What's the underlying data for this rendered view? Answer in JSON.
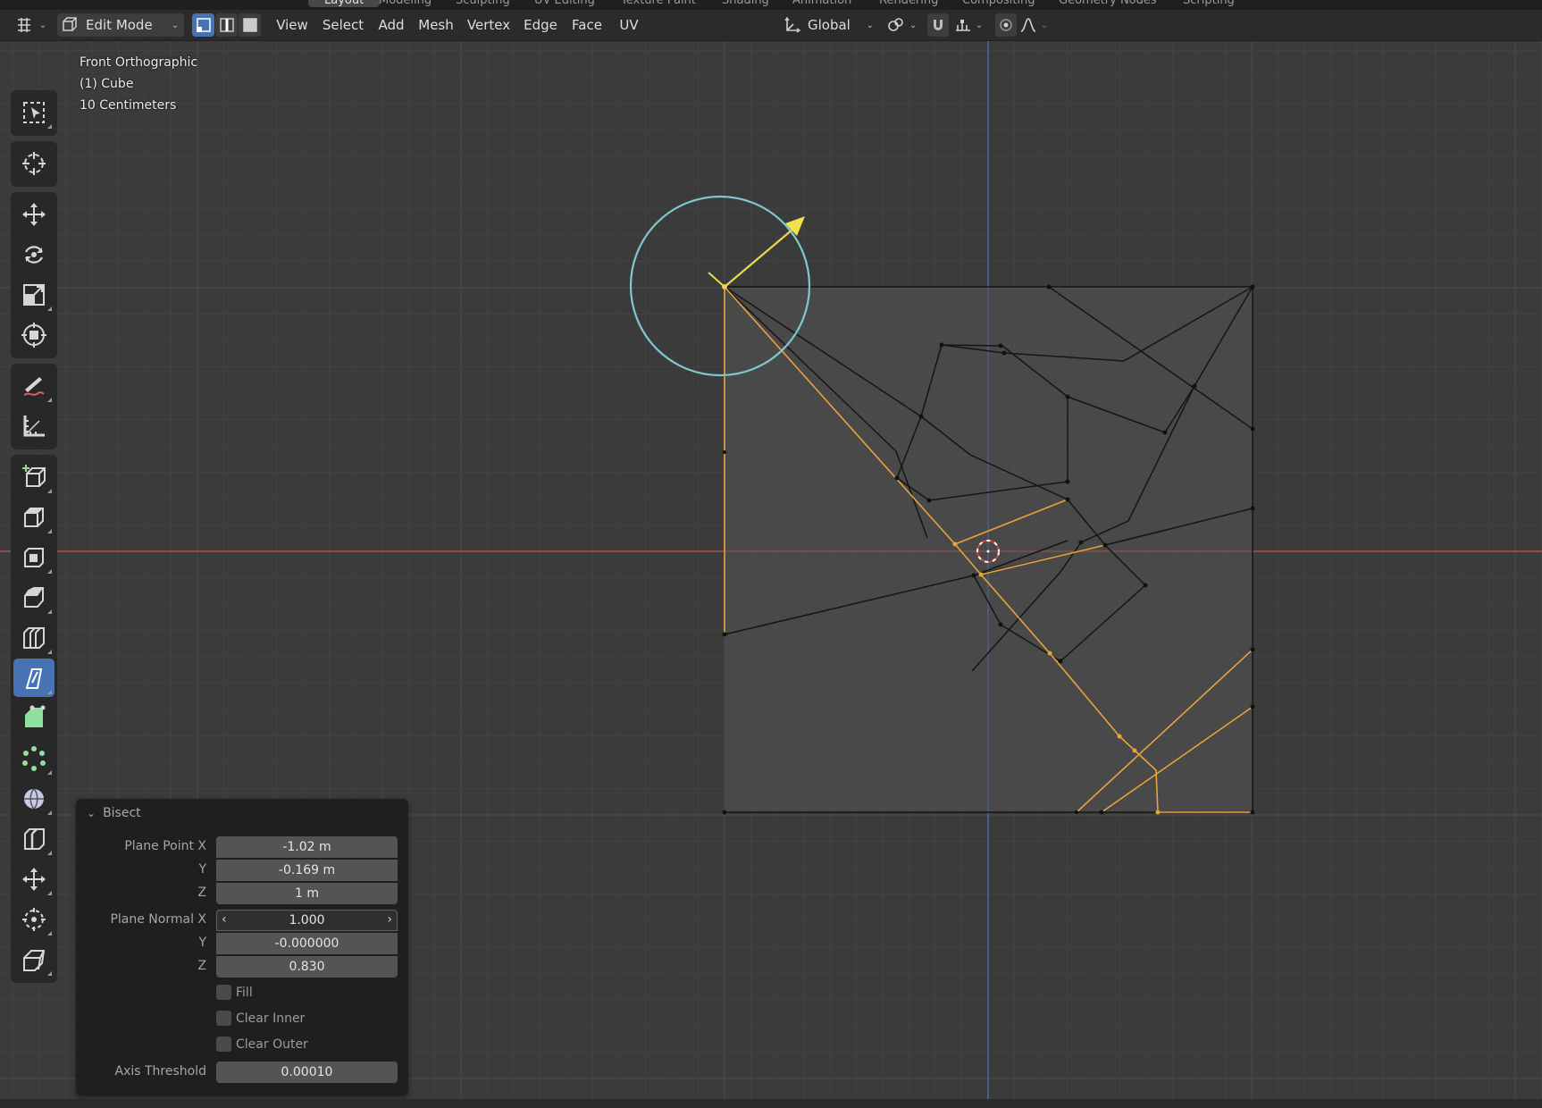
{
  "workspace_tabs": [
    "Layout",
    "Modeling",
    "Sculpting",
    "UV Editing",
    "Texture Paint",
    "Shading",
    "Animation",
    "Rendering",
    "Compositing",
    "Geometry Nodes",
    "Scripting"
  ],
  "header": {
    "mode": "Edit Mode",
    "menus": [
      "View",
      "Select",
      "Add",
      "Mesh",
      "Vertex",
      "Edge",
      "Face",
      "UV"
    ],
    "orientation": "Global"
  },
  "viewport": {
    "view_name": "Front Orthographic",
    "object_name": "(1) Cube",
    "grid_scale": "10 Centimeters"
  },
  "toolbar": {
    "tools": [
      "select-box",
      "cursor",
      "move",
      "rotate",
      "scale",
      "transform",
      "annotate",
      "measure",
      "add-cube",
      "extrude-region",
      "inset-faces",
      "bevel",
      "loop-cut",
      "knife-bisect",
      "poly-build",
      "spin",
      "smooth",
      "edge-slide",
      "shrink-fatten",
      "shear"
    ],
    "active_tool": "knife-bisect"
  },
  "bisect_panel": {
    "title": "Bisect",
    "plane_point_label": "Plane Point X",
    "plane_point_x": "-1.02 m",
    "plane_point_y": "-0.169 m",
    "plane_point_z": "1 m",
    "plane_normal_label": "Plane Normal X",
    "plane_normal_x": "1.000",
    "plane_normal_y": "-0.000000",
    "plane_normal_z": "0.830",
    "y_label": "Y",
    "z_label": "Z",
    "fill_label": "Fill",
    "clear_inner_label": "Clear Inner",
    "clear_outer_label": "Clear Outer",
    "axis_threshold_label": "Axis Threshold",
    "axis_threshold": "0.00010"
  },
  "colors": {
    "x_axis": "#b04a4a",
    "z_axis": "#3f66a8",
    "selected_edge": "#e8a33a",
    "gizmo_circle": "#7ec9cf",
    "gizmo_arrow": "#e8d84a",
    "active_tool_bg": "#4772b3"
  }
}
